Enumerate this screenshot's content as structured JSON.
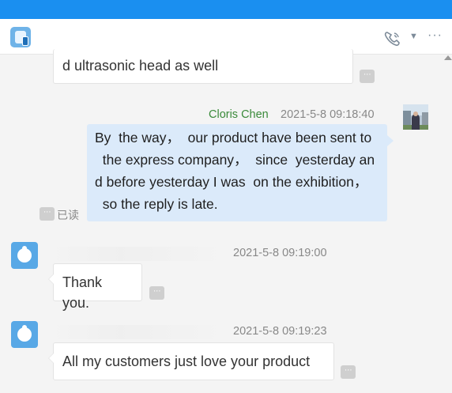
{
  "header": {
    "call_icon": "phone-call-icon",
    "caret_icon": "chevron-down-icon",
    "more_label": "···"
  },
  "messages": {
    "m1": {
      "text": "d ultrasonic head as well"
    },
    "m2": {
      "sender": "Cloris Chen",
      "time": "2021-5-8 09:18:40",
      "lines": [
        "By  the way，  our product have been sent to",
        "  the express company，  since  yesterday an",
        "d before yesterday I was  on the exhibition，",
        "  so the reply is late."
      ],
      "read_status": "已读"
    },
    "m3": {
      "time": "2021-5-8 09:19:00",
      "text": "Thank you."
    },
    "m4": {
      "time": "2021-5-8 09:19:23",
      "text": "All my customers just love your product"
    }
  },
  "more_button_label": "···",
  "colors": {
    "topbar": "#1a8ff0",
    "outgoing_bubble": "#dbeafa",
    "sender_name": "#3a8a3a",
    "avatar_blue": "#58a8e6"
  }
}
